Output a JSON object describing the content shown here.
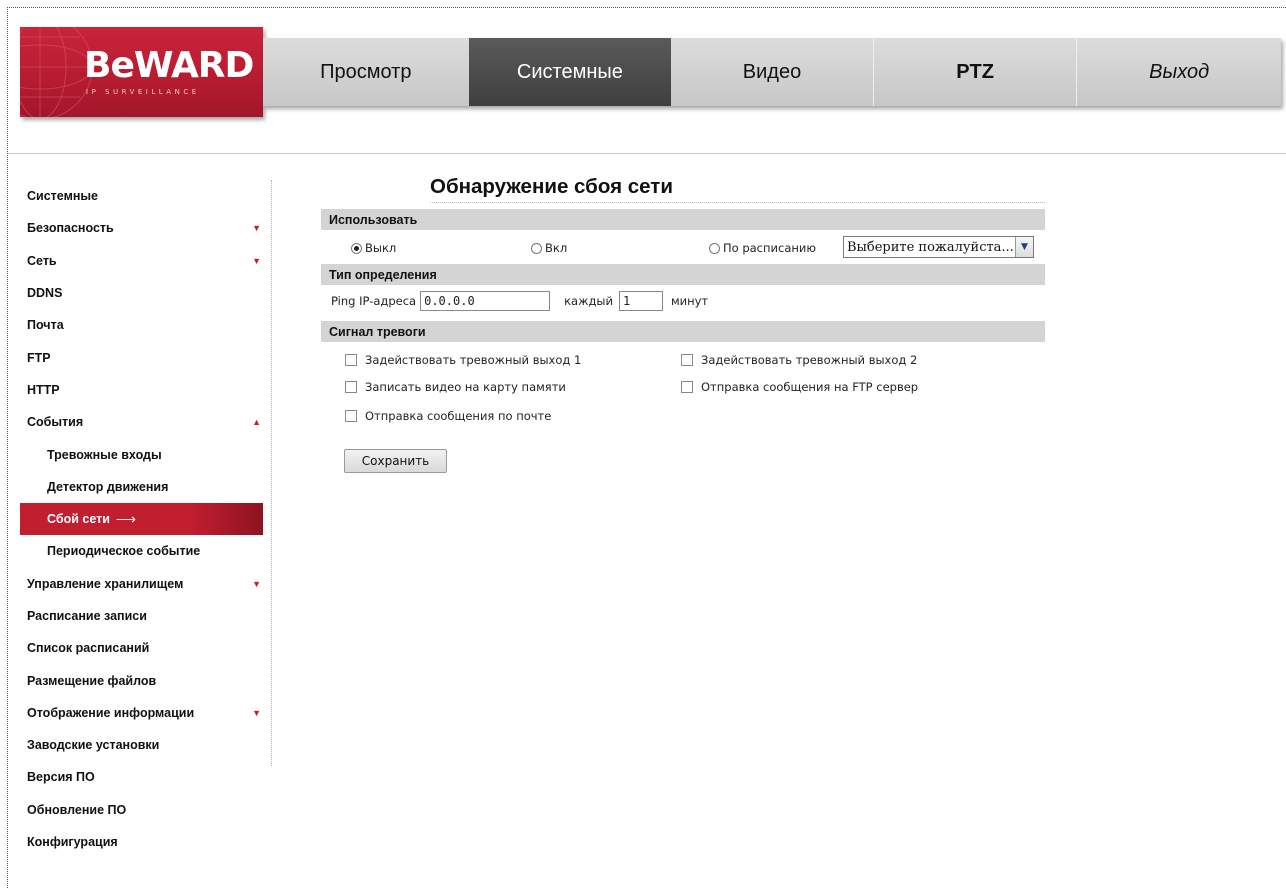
{
  "logo": {
    "text": "BeWARD",
    "subtitle": "IP SURVEILLANCE"
  },
  "topnav": [
    {
      "label": "Просмотр"
    },
    {
      "label": "Системные",
      "active": true
    },
    {
      "label": "Видео"
    },
    {
      "label": "PTZ"
    },
    {
      "label": "Выход"
    }
  ],
  "sidebar": {
    "items": [
      {
        "label": "Системные"
      },
      {
        "label": "Безопасность",
        "arrow": "down"
      },
      {
        "label": "Сеть",
        "arrow": "down"
      },
      {
        "label": "DDNS"
      },
      {
        "label": "Почта"
      },
      {
        "label": "FTP"
      },
      {
        "label": "HTTP"
      },
      {
        "label": "События",
        "arrow": "up"
      },
      {
        "label": "Тревожные входы",
        "sub": true
      },
      {
        "label": "Детектор движения",
        "sub": true
      },
      {
        "label": "Сбой сети",
        "sub": true,
        "active": true
      },
      {
        "label": "Периодическое событие",
        "sub": true
      },
      {
        "label": "Управление хранилищем",
        "arrow": "down"
      },
      {
        "label": "Расписание записи"
      },
      {
        "label": "Список расписаний"
      },
      {
        "label": "Размещение файлов"
      },
      {
        "label": "Отображение информации",
        "arrow": "down"
      },
      {
        "label": "Заводские установки"
      },
      {
        "label": "Версия ПО"
      },
      {
        "label": "Обновление ПО"
      },
      {
        "label": "Конфигурация"
      }
    ]
  },
  "main": {
    "title": "Обнаружение сбоя сети",
    "use_section": {
      "header": "Использовать",
      "radio_off": "Выкл",
      "radio_on": "Вкл",
      "radio_schedule": "По расписанию",
      "selected": "off",
      "schedule_select": "Выберите пожалуйста..."
    },
    "detect_section": {
      "header": "Тип определения",
      "ping_label": "Ping IP-адреса",
      "ping_value": "0.0.0.0",
      "every_label": "каждый",
      "every_value": "1",
      "minutes_label": "минут"
    },
    "alarm_section": {
      "header": "Сигнал тревоги",
      "options": [
        "Задействовать тревожный выход 1",
        "Задействовать тревожный выход 2",
        "Записать видео на карту памяти",
        "Отправка сообщения на FTP сервер",
        "Отправка сообщения по почте"
      ]
    },
    "save_label": "Сохранить"
  },
  "colors": {
    "brand_red": "#c11e2f",
    "nav_active": "#4a4a4a",
    "section_bar": "#d4d4d4"
  }
}
